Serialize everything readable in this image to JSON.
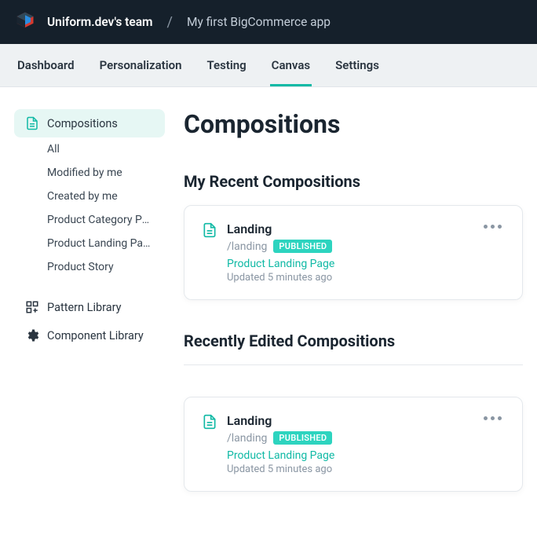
{
  "colors": {
    "accent": "#10b9a5",
    "topbar_bg": "#15202b",
    "badge_bg": "#2dd4bf"
  },
  "header": {
    "team": "Uniform.dev's team",
    "separator": "/",
    "app": "My first BigCommerce app"
  },
  "tabs": [
    {
      "label": "Dashboard",
      "active": false
    },
    {
      "label": "Personalization",
      "active": false
    },
    {
      "label": "Testing",
      "active": false
    },
    {
      "label": "Canvas",
      "active": true
    },
    {
      "label": "Settings",
      "active": false
    }
  ],
  "sidebar": {
    "compositions_label": "Compositions",
    "sub_items": [
      "All",
      "Modified by me",
      "Created by me",
      "Product Category Pa...",
      "Product Landing Page",
      "Product Story"
    ],
    "pattern_library_label": "Pattern Library",
    "component_library_label": "Component Library"
  },
  "page": {
    "title": "Compositions",
    "recent_heading": "My Recent Compositions",
    "recent_card": {
      "title": "Landing",
      "slug": "/landing",
      "status": "PUBLISHED",
      "template": "Product Landing Page",
      "updated": "Updated 5 minutes ago"
    },
    "edited_heading": "Recently Edited Compositions",
    "edited_card": {
      "title": "Landing",
      "slug": "/landing",
      "status": "PUBLISHED",
      "template": "Product Landing Page",
      "updated": "Updated 5 minutes ago"
    }
  }
}
